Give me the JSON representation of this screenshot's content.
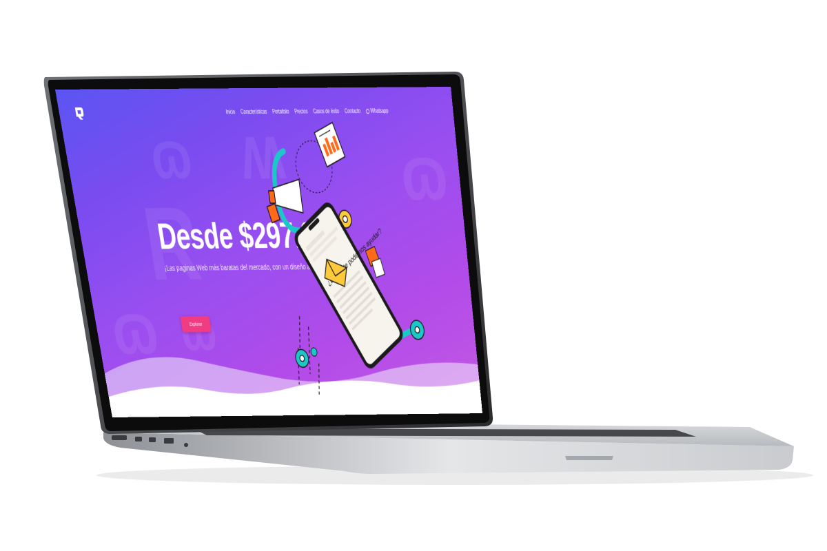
{
  "nav": {
    "items": [
      {
        "label": "Inicio"
      },
      {
        "label": "Características"
      },
      {
        "label": "Portafolio"
      },
      {
        "label": "Precios"
      },
      {
        "label": "Casos de éxito"
      },
      {
        "label": "Contacto"
      }
    ],
    "whatsapp_label": "Whatsapp"
  },
  "hero": {
    "title": "Desde $297.000",
    "subtitle": "¡Las paginas Web más baratas del mercado, con un diseño alucinante!",
    "cta_label": "Explorar"
  },
  "phone": {
    "headline": "¿En qué te podemos ayudar?"
  },
  "colors": {
    "gradient_start": "#5b55f2",
    "gradient_end": "#c55ae3",
    "cta": "#f03c82",
    "illustration_teal": "#1ec7c7",
    "illustration_orange": "#ff6a1a",
    "illustration_yellow": "#ffc93c"
  },
  "icons": {
    "logo": "brand-logo-icon",
    "whatsapp": "whatsapp-icon",
    "gear": "gear-icon",
    "envelope": "envelope-icon",
    "document": "chart-document-icon",
    "megaphone": "megaphone-icon"
  }
}
